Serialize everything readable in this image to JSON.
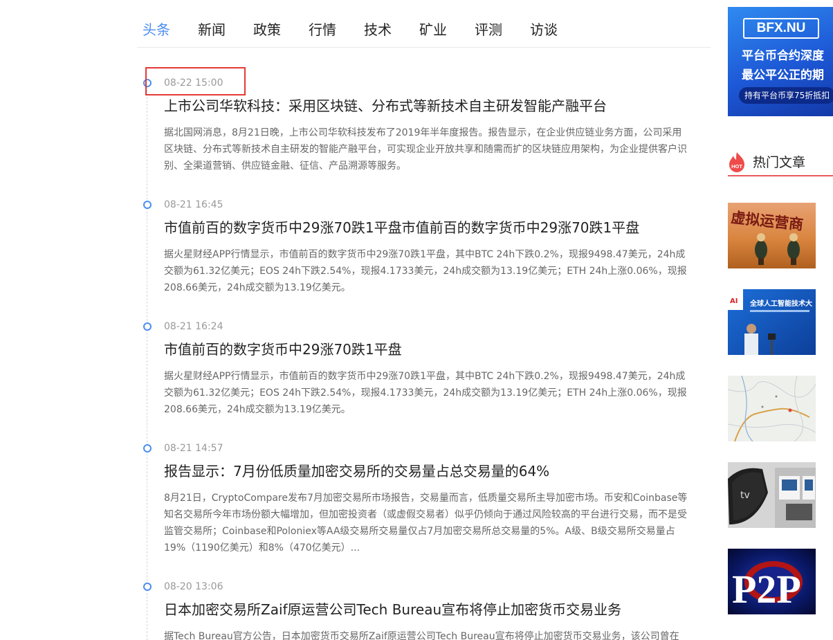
{
  "tabs": [
    "头条",
    "新闻",
    "政策",
    "行情",
    "技术",
    "矿业",
    "评测",
    "访谈"
  ],
  "active_tab": 0,
  "articles": [
    {
      "time": "08-22 15:00",
      "title": "上市公司华软科技：采用区块链、分布式等新技术自主研发智能产融平台",
      "summary": "据北国网消息，8月21日晚，上市公司华软科技发布了2019年半年度报告。报告显示，在企业供应链业务方面，公司采用区块链、分布式等新技术自主研发的智能产融平台，可实现企业开放共享和随需而扩的区块链应用架构，为企业提供客户识别、全渠道营销、供应链金融、征信、产品溯源等服务。"
    },
    {
      "time": "08-21 16:45",
      "title": "市值前百的数字货币中29涨70跌1平盘市值前百的数字货币中29涨70跌1平盘",
      "summary": "据火星财经APP行情显示，市值前百的数字货币中29涨70跌1平盘，其中BTC 24h下跌0.2%，现报9498.47美元，24h成交额为61.32亿美元；EOS 24h下跌2.54%，现报4.1733美元，24h成交额为13.19亿美元；ETH 24h上涨0.06%，现报208.66美元，24h成交额为13.19亿美元。"
    },
    {
      "time": "08-21 16:24",
      "title": "市值前百的数字货币中29涨70跌1平盘",
      "summary": "据火星财经APP行情显示，市值前百的数字货币中29涨70跌1平盘，其中BTC 24h下跌0.2%，现报9498.47美元，24h成交额为61.32亿美元；EOS 24h下跌2.54%，现报4.1733美元，24h成交额为13.19亿美元；ETH 24h上涨0.06%，现报208.66美元，24h成交额为13.19亿美元。"
    },
    {
      "time": "08-21 14:57",
      "title": "报告显示：7月份低质量加密交易所的交易量占总交易量的64%",
      "summary": "8月21日，CryptoCompare发布7月加密交易所市场报告，交易量而言，低质量交易所主导加密市场。币安和Coinbase等知名交易所今年市场份额大幅增加，但加密投资者（或虚假交易者）似乎仍倾向于通过风险较高的平台进行交易，而不是受监管交易所；Coinbase和Poloniex等AA级交易所交易量仅占7月加密交易所总交易量的5%。A级、B级交易所交易量占19%（1190亿美元）和8%（470亿美元）..."
    },
    {
      "time": "08-20 13:06",
      "title": "日本加密交易所Zaif原运营公司Tech Bureau宣布将停止加密货币交易业务",
      "summary": "据Tech Bureau官方公告，日本加密货币交易所Zaif原运营公司Tech Bureau宣布将停止加密货币交易业务，该公司曾在"
    }
  ],
  "sidebar": {
    "banner": {
      "brand": "BFX.NU",
      "line1": "平台币合约深度",
      "line2": "最公平公正的期",
      "line3": "持有平台币享75折抵扣"
    },
    "hot": {
      "badge": "HOT",
      "title": "热门文章"
    },
    "thumbs": [
      "虚拟运营商",
      "全球人工智能技术大"
    ]
  }
}
